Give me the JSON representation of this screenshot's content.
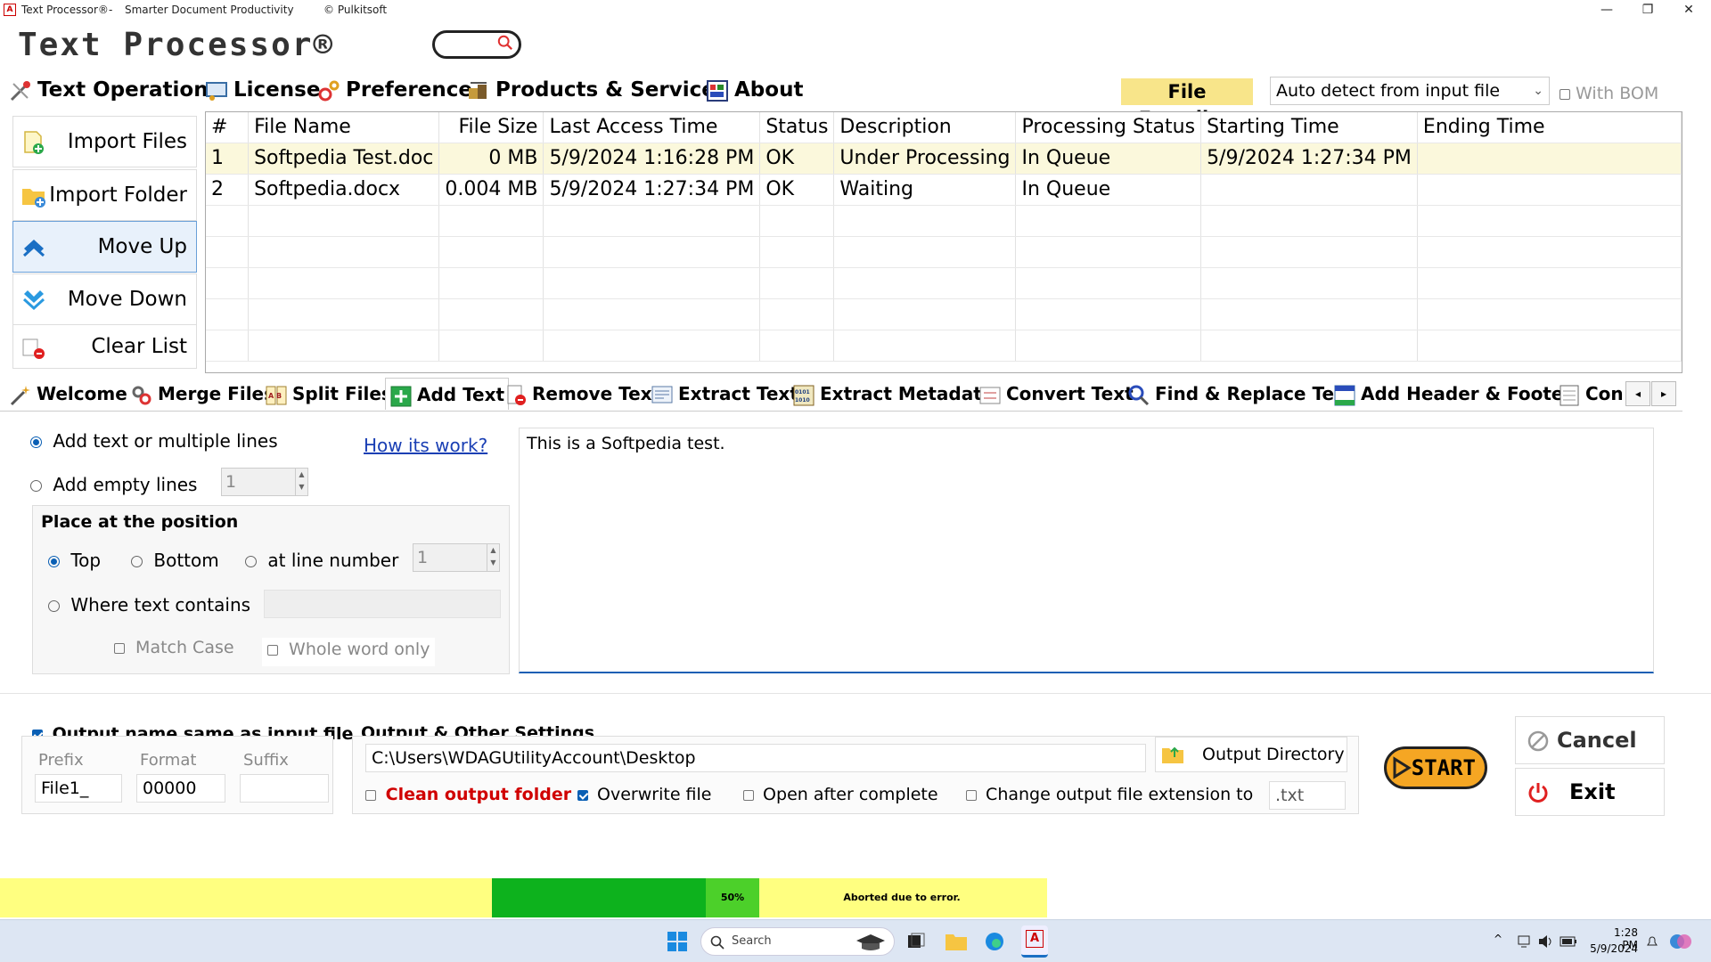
{
  "window": {
    "app_name": "Text Processor®",
    "separator": "-",
    "subtitle": "Smarter Document Productivity",
    "copyright": "© Pulkitsoft",
    "minimize": "—",
    "restore": "❐",
    "close": "✕"
  },
  "header": {
    "title": "Text Processor®"
  },
  "menu": [
    {
      "label": "Text Operations"
    },
    {
      "label": "License"
    },
    {
      "label": "Preference"
    },
    {
      "label": "Products & Services"
    },
    {
      "label": "About"
    }
  ],
  "encoding": {
    "label": "File Encoding",
    "selected": "Auto detect from input file",
    "bom_label": "With BOM"
  },
  "sidebar": {
    "import_files": "Import Files",
    "import_folder": "Import Folder",
    "move_up": "Move Up",
    "move_down": "Move Down",
    "clear_list": "Clear List"
  },
  "table": {
    "columns": [
      "#",
      "File Name",
      "File Size",
      "Last Access Time",
      "Status",
      "Description",
      "Processing Status",
      "Starting Time",
      "Ending Time"
    ],
    "rows": [
      [
        "1",
        "Softpedia Test.doc",
        "0 MB",
        "5/9/2024 1:16:28 PM",
        "OK",
        "Under Processing",
        "In Queue",
        "5/9/2024 1:27:34 PM",
        ""
      ],
      [
        "2",
        "Softpedia.docx",
        "0.004 MB",
        "5/9/2024 1:27:34 PM",
        "OK",
        "Waiting",
        "In Queue",
        "",
        ""
      ]
    ]
  },
  "tabs": [
    {
      "label": "Welcome"
    },
    {
      "label": "Merge Files"
    },
    {
      "label": "Split Files"
    },
    {
      "label": "Add Text"
    },
    {
      "label": "Remove Text"
    },
    {
      "label": "Extract Text"
    },
    {
      "label": "Extract Metadata"
    },
    {
      "label": "Convert Text"
    },
    {
      "label": "Find & Replace Text"
    },
    {
      "label": "Add Header & Footer"
    },
    {
      "label": "Conv"
    }
  ],
  "add_text": {
    "opt_multiple": "Add text or multiple lines",
    "how_link": "How its work?",
    "opt_empty": "Add empty lines",
    "empty_count": "1",
    "position_title": "Place at the position",
    "pos_top": "Top",
    "pos_bottom": "Bottom",
    "pos_line": "at line number",
    "line_number": "1",
    "pos_contains": "Where text contains",
    "match_case": "Match Case",
    "whole_word": "Whole word only",
    "text": "This is a Softpedia test."
  },
  "output": {
    "same_name": "Output name same as input file",
    "prefix_label": "Prefix",
    "format_label": "Format",
    "suffix_label": "Suffix",
    "prefix": "File1_",
    "format": "00000",
    "settings_title": "Output & Other Settings",
    "directory": "C:\\Users\\WDAGUtilityAccount\\Desktop",
    "dir_button": "Output Directory",
    "clean_folder": "Clean output folder",
    "overwrite": "Overwrite file",
    "open_after": "Open after complete",
    "change_ext": "Change output file extension to",
    "ext": ".txt",
    "start": "START",
    "cancel": "Cancel",
    "exit": "Exit"
  },
  "progress": {
    "percent_label": "50%",
    "value": 0.5,
    "message": "Aborted due to error."
  },
  "taskbar": {
    "search": "Search",
    "time": "1:28 PM",
    "date": "5/9/2024"
  },
  "colors": {
    "accent": "#0a5fb4",
    "progress_fill": "#0db21d",
    "progress_bg": "#ffff80",
    "encoding_bg": "#f8e58a",
    "clean_red": "#d00000",
    "start_bg": "#f5a623"
  }
}
